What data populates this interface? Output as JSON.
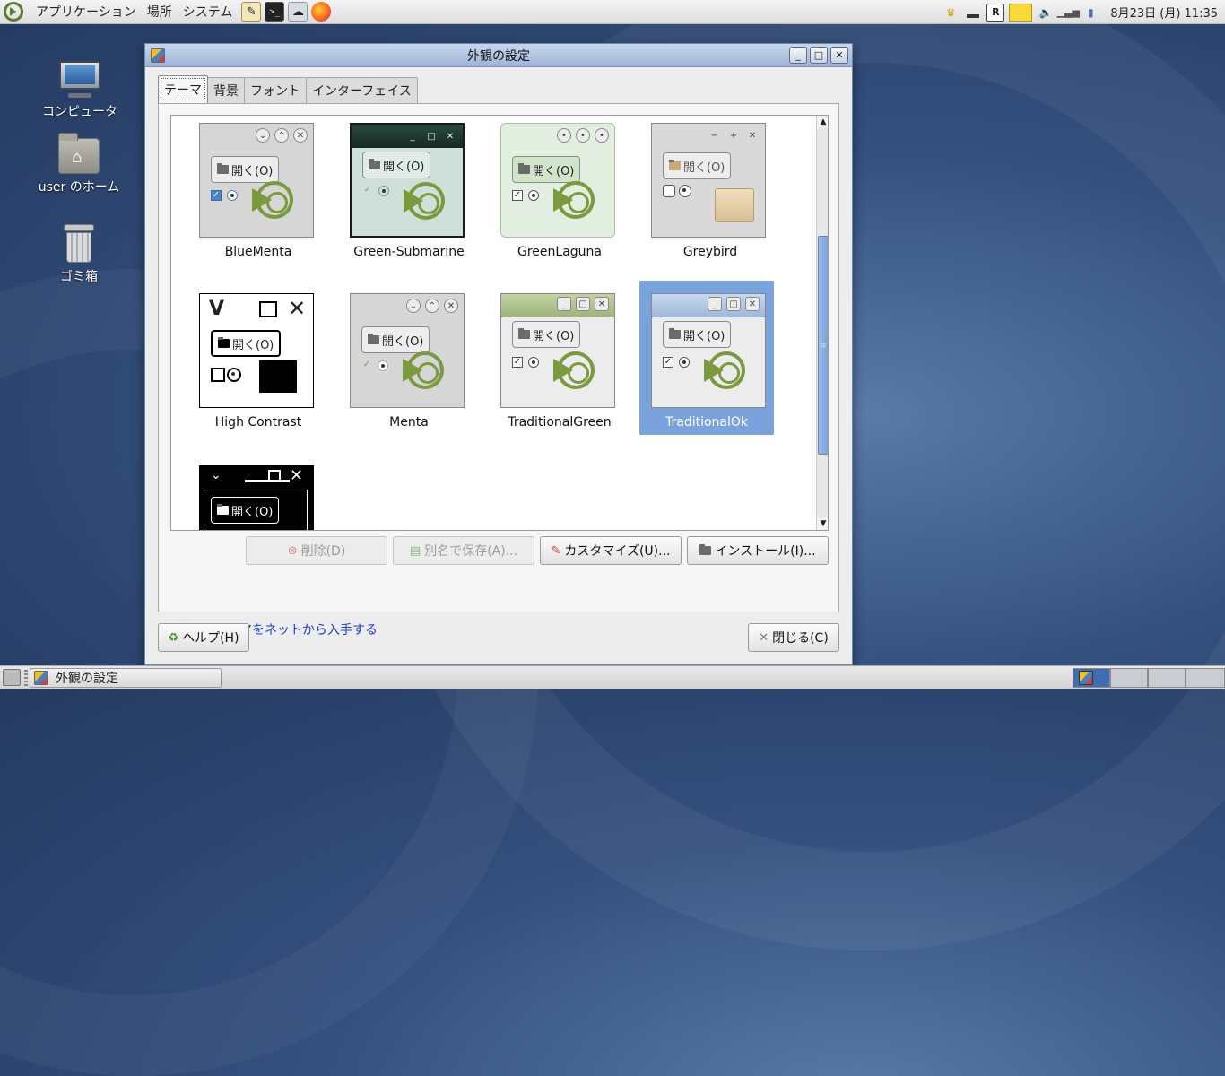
{
  "top_panel": {
    "menus": [
      "アプリケーション",
      "場所",
      "システム"
    ],
    "launchers": [
      "text-editor-icon",
      "terminal-icon",
      "network-icon",
      "firefox-icon"
    ],
    "clock": "8月23日 (月) 11:35"
  },
  "desktop": {
    "icons": [
      {
        "label": "コンピュータ",
        "icon": "computer-icon"
      },
      {
        "label": "user のホーム",
        "icon": "home-folder-icon"
      },
      {
        "label": "ゴミ箱",
        "icon": "trash-icon"
      }
    ]
  },
  "window": {
    "title": "外観の設定",
    "tabs": [
      "テーマ",
      "背景",
      "フォント",
      "インターフェイス"
    ],
    "active_tab": "テーマ",
    "preview_button_label": "開く(O)",
    "themes": [
      {
        "name": "BlueMenta",
        "selected": false
      },
      {
        "name": "Green-Submarine",
        "selected": false
      },
      {
        "name": "GreenLaguna",
        "selected": false
      },
      {
        "name": "Greybird",
        "selected": false
      },
      {
        "name": "High Contrast",
        "selected": false
      },
      {
        "name": "Menta",
        "selected": false
      },
      {
        "name": "TraditionalGreen",
        "selected": false
      },
      {
        "name": "TraditionalOk",
        "selected": true
      },
      {
        "name": "",
        "selected": false
      }
    ],
    "buttons": {
      "delete": "削除(D)",
      "save_as": "別名で保存(A)...",
      "customize": "カスタマイズ(U)...",
      "install": "インストール(I)..."
    },
    "link": "追加のテーマをネットから入手する",
    "help": "ヘルプ(H)",
    "close": "閉じる(C)"
  },
  "taskbar": {
    "task_label": "外観の設定"
  },
  "colors": {
    "selection": "#7aa2dc",
    "accent_green": "#7a9a3e",
    "link": "#1c3fd0"
  }
}
